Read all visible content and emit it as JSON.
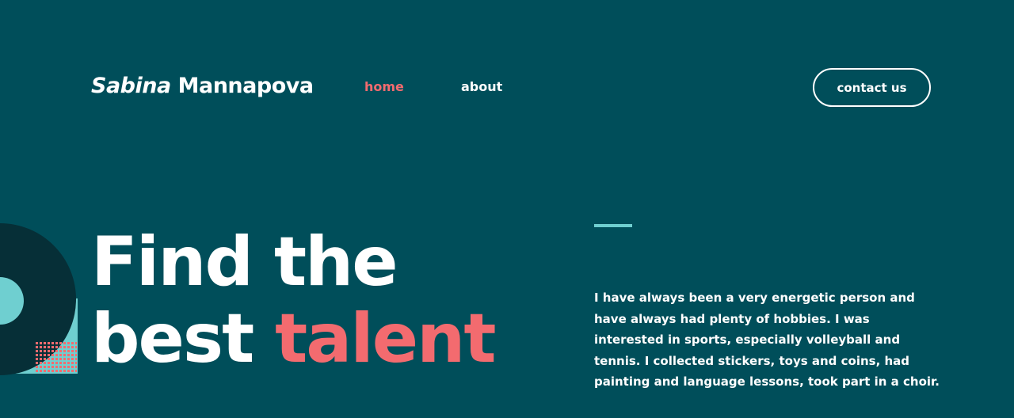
{
  "header": {
    "logo_first": "Sabina",
    "logo_last": "Mannapova",
    "nav": [
      {
        "label": "home",
        "active": true
      },
      {
        "label": "about",
        "active": false
      }
    ],
    "contact_label": "contact us"
  },
  "hero": {
    "line1": "Find the",
    "line2_plain": "best",
    "line2_accent": "talent",
    "paragraph": "I have always been a very energetic person and have always had plenty of hobbies. I was interested in sports, especially volleyball and tennis. I collected stickers, toys and coins, had painting and language lessons, took part in a choir."
  },
  "colors": {
    "background": "#004e5a",
    "accent": "#f36b6f",
    "teal": "#6fcfd0",
    "dark": "#062f37"
  },
  "icons": {
    "decoration": "geometric-shapes-decoration"
  }
}
